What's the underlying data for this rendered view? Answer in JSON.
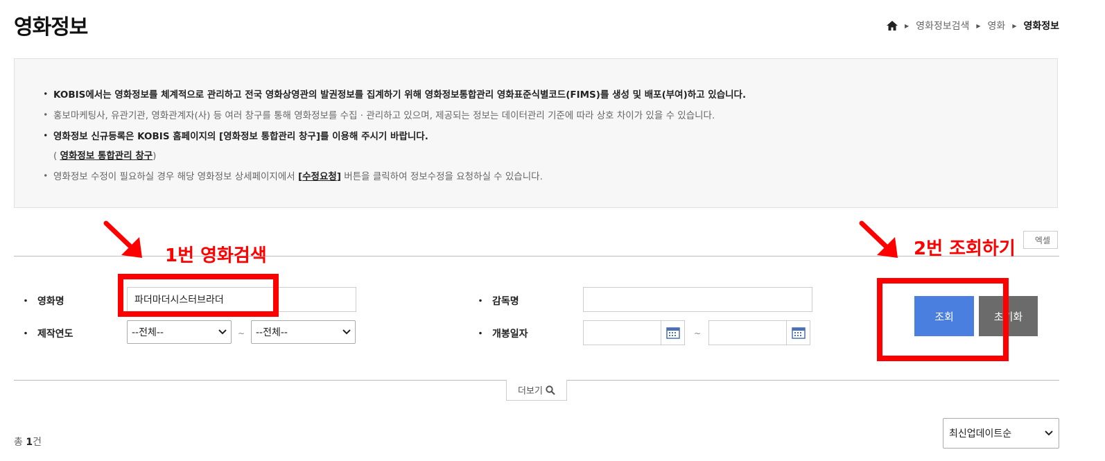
{
  "header": {
    "title": "영화정보",
    "breadcrumb": [
      "영화정보검색",
      "영화",
      "영화정보"
    ]
  },
  "info": {
    "line1": "KOBIS에서는 영화정보를 체계적으로 관리하고 전국 영화상영관의 발권정보를 집계하기 위해 영화정보통합관리 영화표준식별코드(FIMS)를 생성 및 배포(부여)하고 있습니다.",
    "line2": "홍보마케팅사, 유관기관, 영화관계자(사) 등 여러 창구를 통해 영화정보를 수집 · 관리하고 있으며, 제공되는 정보는 데이터관리 기준에 따라 상호 차이가 있을 수 있습니다.",
    "line3": "영화정보 신규등록은 KOBIS 홈페이지의 [영화정보 통합관리 창구]를 이용해 주시기 바랍니다.",
    "line4_open": "( ",
    "line4_link": "영화정보 통합관리 창구",
    "line4_close": ")",
    "line5_pre": "영화정보 수정이 필요하실 경우 해당 영화정보 상세페이지에서 ",
    "line5_bracket_open": "[",
    "line5_link": "수정요청",
    "line5_bracket_close": "]",
    "line5_post": " 버튼을 클릭하여 정보수정을 요청하실 수 있습니다."
  },
  "toolbar": {
    "excel_label": "엑셀"
  },
  "form": {
    "bullet": "・",
    "title_label": "영화명",
    "title_value": "파더마더시스터브라더",
    "director_label": "감독명",
    "director_value": "",
    "year_label": "제작연도",
    "year_from": "--전체--",
    "year_to": "--전체--",
    "release_label": "개봉일자",
    "release_from": "",
    "release_to": "",
    "tilde": "~",
    "search_label": "조회",
    "reset_label": "초기화"
  },
  "more": {
    "label": "더보기"
  },
  "results": {
    "total_prefix": "총 ",
    "total_count": "1",
    "total_suffix": "건",
    "sort_value": "최신업데이트순"
  },
  "annotations": {
    "step1": "1번 영화검색",
    "step2": "2번 조회하기"
  },
  "colors": {
    "search_button": "#4a7fe0",
    "reset_button": "#6b6b6b",
    "annotation": "#ff0000"
  }
}
